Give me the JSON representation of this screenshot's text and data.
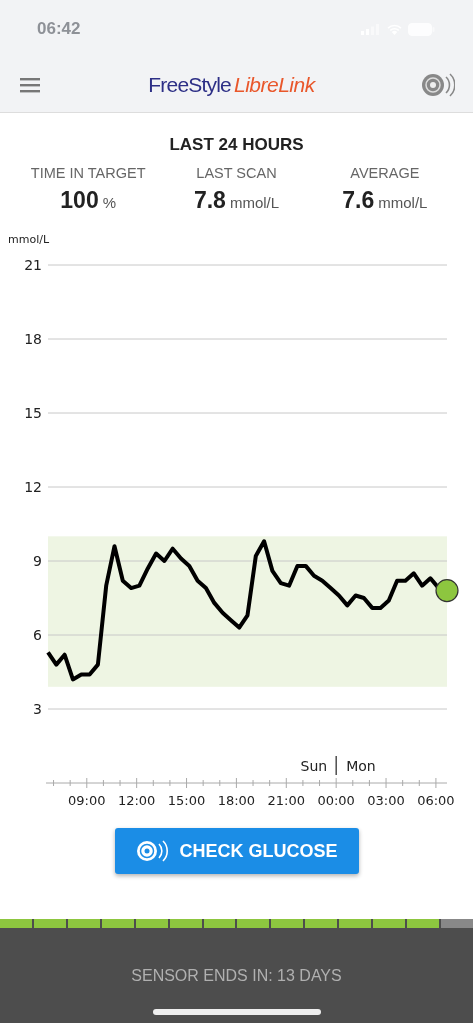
{
  "status_bar": {
    "time": "06:42"
  },
  "header": {
    "logo": {
      "brand": "FreeStyle",
      "product": "LibreLink"
    }
  },
  "summary": {
    "title": "LAST 24 HOURS",
    "stats": [
      {
        "label": "TIME IN TARGET",
        "value": "100",
        "unit": "%"
      },
      {
        "label": "LAST SCAN",
        "value": "7.8",
        "unit": "mmol/L"
      },
      {
        "label": "AVERAGE",
        "value": "7.6",
        "unit": "mmol/L"
      }
    ]
  },
  "chart": {
    "chart_data": {
      "type": "line",
      "ylabel": "mmol/L",
      "series": [
        {
          "color": "#000000",
          "values": [
            5.3,
            4.8,
            5.2,
            4.2,
            4.4,
            4.4,
            4.8,
            8.0,
            9.6,
            8.2,
            7.9,
            8.0,
            8.7,
            9.3,
            9.0,
            9.5,
            9.1,
            8.8,
            8.2,
            7.9,
            7.3,
            6.9,
            6.6,
            6.3,
            6.8,
            9.2,
            9.8,
            8.6,
            8.1,
            8.0,
            8.8,
            8.8,
            8.4,
            8.2,
            7.9,
            7.6,
            7.2,
            7.6,
            7.5,
            7.1,
            7.1,
            7.4,
            8.2,
            8.2,
            8.5,
            8.0,
            8.3,
            7.9,
            7.8
          ]
        }
      ],
      "ylim": [
        0,
        21
      ],
      "grid": true,
      "yticks": [
        3,
        6,
        9,
        12,
        15,
        18,
        21
      ],
      "bands": [
        {
          "axis": "y",
          "from": 3.9,
          "to": 10
        }
      ]
    },
    "day_labels": [
      "Sun",
      "Mon"
    ],
    "time_labels": [
      "09:00",
      "12:00",
      "15:00",
      "18:00",
      "21:00",
      "00:00",
      "03:00",
      "06:00"
    ]
  },
  "check_button": {
    "label": "CHECK GLUCOSE"
  },
  "sensor": {
    "level": 0.93,
    "text": "SENSOR ENDS IN: 13 DAYS"
  }
}
